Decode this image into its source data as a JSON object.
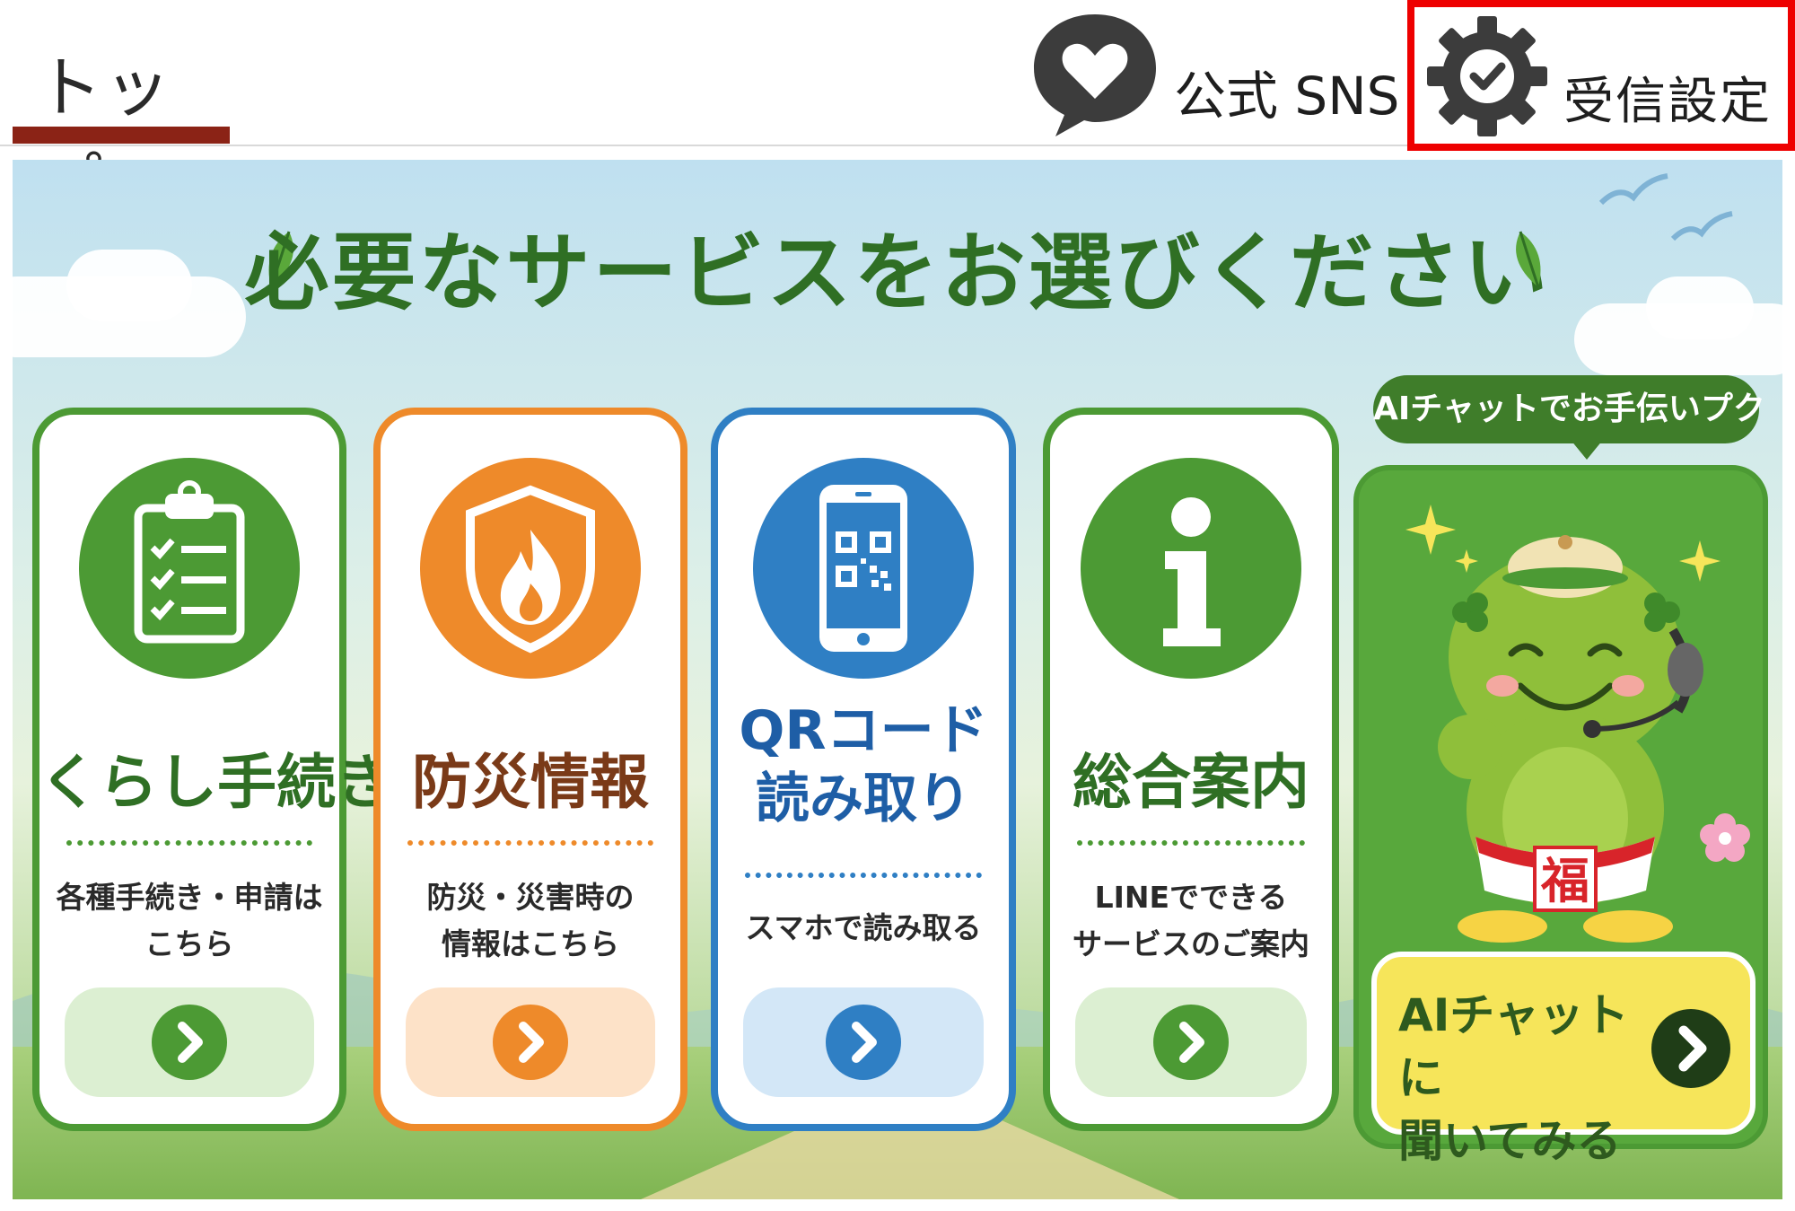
{
  "header": {
    "tab_top": "トップ",
    "sns_label": "公式 SNS",
    "sns_icon": "heart-speech-bubble-icon",
    "receive_label": "受信設定",
    "receive_icon": "gear-check-icon"
  },
  "banner": {
    "headline": "必要なサービスをお選びください"
  },
  "cards": [
    {
      "title": "くらし手続き",
      "desc_line1": "各種手続き・申請は",
      "desc_line2": "こちら",
      "icon": "clipboard-checklist-icon",
      "color": "#4c9a34"
    },
    {
      "title": "防災情報",
      "desc_line1": "防災・災害時の",
      "desc_line2": "情報はこちら",
      "icon": "shield-flame-icon",
      "color": "#ee8a2a"
    },
    {
      "title_line1": "QRコード",
      "title_line2": "読み取り",
      "desc_line1": "スマホで読み取る",
      "icon": "smartphone-qr-icon",
      "color": "#2f7fc4"
    },
    {
      "title": "総合案内",
      "desc_line1": "LINEでできる",
      "desc_line2": "サービスのご案内",
      "icon": "info-icon",
      "color": "#4c9a34"
    }
  ],
  "ai": {
    "bubble": "AIチャットでお手伝いプク",
    "cta_line1": "AIチャットに",
    "cta_line2": "聞いてみる",
    "mascot_badge": "福"
  },
  "colors": {
    "accent_underline": "#8b2316",
    "highlight_border": "#ee0000",
    "green": "#4c9a34",
    "orange": "#ee8a2a",
    "blue": "#2f7fc4"
  }
}
